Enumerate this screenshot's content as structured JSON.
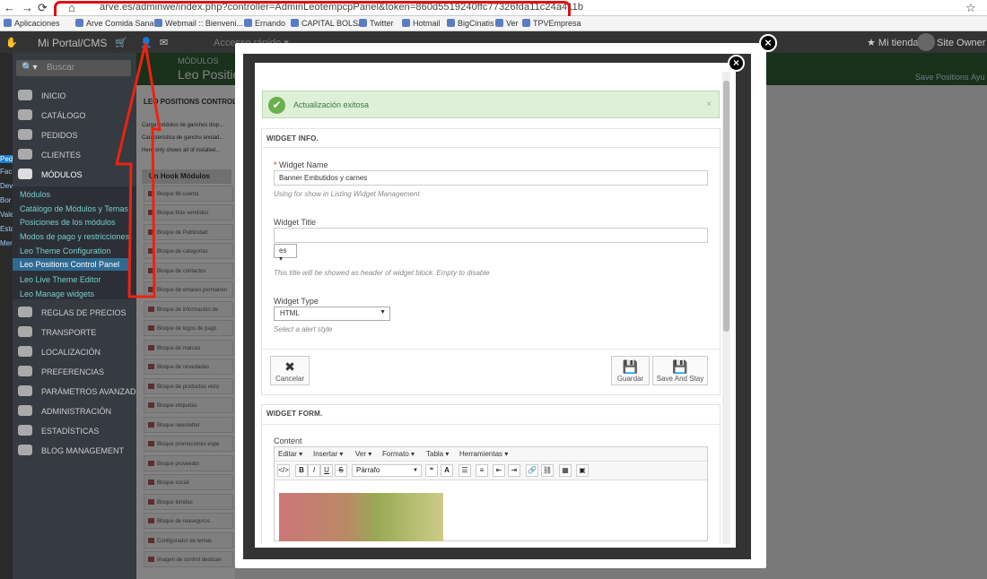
{
  "browser": {
    "url": "arve.es/adminwe/index.php?controller=AdminLeotempcpPanel&token=860d5519240ffc77326fda11c24a411b",
    "star": "☆"
  },
  "bookmarks": [
    "Aplicaciones",
    "Arve Comida Sana",
    "Webmail :: Bienveni...",
    "Ernando",
    "CAPITAL BOLSA",
    "Twitter",
    "Hotmail",
    "BigCinatis",
    "Ver",
    "TPVEmpresa"
  ],
  "topbar": {
    "brand": "Mi Portal/CMS",
    "quick": "Accesso rápido ▾",
    "shop": "Mi tienda",
    "owner": "Site Owner ▾"
  },
  "sidebar": {
    "search_placeholder": "Buscar",
    "items": [
      "Inicio",
      "Catálogo",
      "Pedidos",
      "Clientes",
      "Módulos",
      "Reglas de precios",
      "Transporte",
      "Localización",
      "Preferencias",
      "Parámetros avanzados",
      "Administración",
      "Estadísticas",
      "Blog Management"
    ],
    "submenu": [
      "Módulos",
      "Catálogo de Módulos y Temas",
      "Posiciones de los módulos",
      "Modos de pago y restricciones",
      "Leo Theme Configuration",
      "Leo Positions Control Panel",
      "Leo Live Theme Editor",
      "Leo Manage widgets"
    ]
  },
  "page": {
    "breadcrumb": "MÓDULOS",
    "title": "Leo Position",
    "save_positions": "Save Positions",
    "help": "Ayu",
    "panel_title": "LEO POSITIONS CONTROL PA",
    "tab": "Un Hook Módulos",
    "notes": [
      "Carga módulos de ganchos disp...",
      "Característica de gancho anulad...",
      "Here only shows all of installed..."
    ],
    "hooks": [
      "Bloque Mi cuenta",
      "Bloque Más vendidos",
      "Bloque de Publicidad",
      "Bloque de categorías",
      "Bloque de contactos",
      "Bloque de enlaces permanen",
      "Bloque de información de",
      "Bloque de logos de pago",
      "Bloque de marcas",
      "Bloque de novedades",
      "Bloque de productos visto",
      "Bloque etiquetas",
      "Bloque newsletter",
      "Bloque promociones espe",
      "Bloque proveedor",
      "Bloque social",
      "Bloque tiendas",
      "Bloque de reaseguros",
      "Configurador de temas",
      "Imagen de control deslizan"
    ]
  },
  "modal": {
    "success": "Actualización exitosa",
    "info_title": "WIDGET INFO.",
    "name_label": "Widget Name",
    "name_value": "Banner Embutidos y carnes",
    "name_hint": "Using for show in Listing Widget Management",
    "title_label": "Widget Title",
    "title_value": "",
    "lang": "es ▾",
    "title_hint": "This title will be showed as header of widget block. Empty to disable",
    "type_label": "Widget Type",
    "type_value": "HTML",
    "type_hint": "Select a alert style",
    "cancel": "Cancelar",
    "save": "Guardar",
    "save_stay": "Save And Stay",
    "form_title": "WIDGET FORM.",
    "content_label": "Content",
    "editor_menu": [
      "Editar ▾",
      "Insertar ▾",
      "Ver ▾",
      "Formato ▾",
      "Tabla ▾",
      "Herramientas ▾"
    ],
    "paragraph": "Párrafo"
  }
}
